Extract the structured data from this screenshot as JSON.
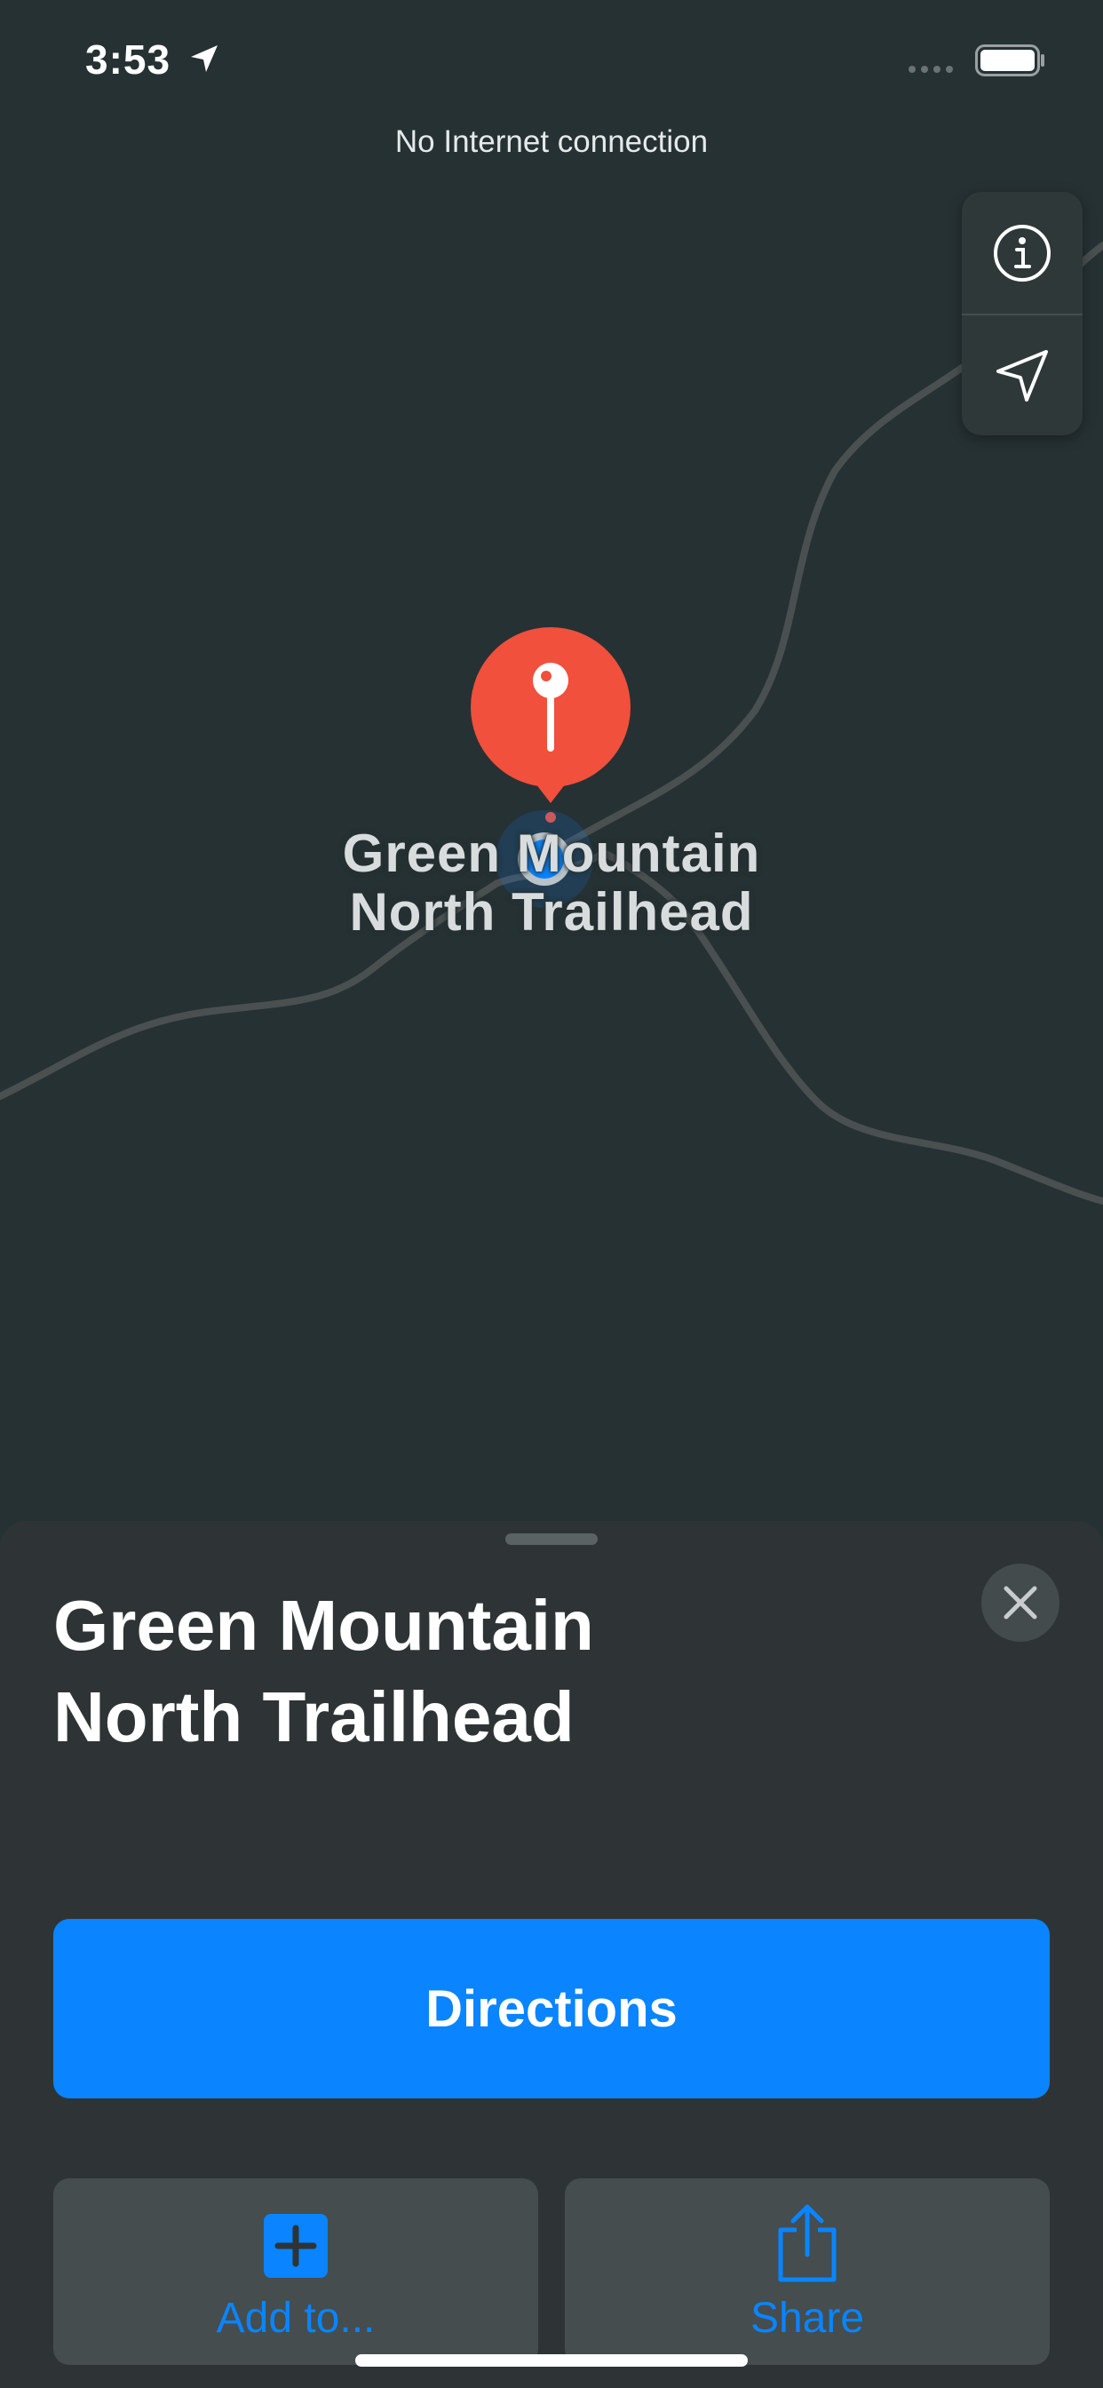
{
  "status_bar": {
    "time": "3:53",
    "location_icon": "location-arrow-icon",
    "signal_icon": "cellular-signal-icon",
    "battery_icon": "battery-icon"
  },
  "map": {
    "banner": "No Internet connection",
    "pin_label": "Green Mountain\nNorth Trailhead",
    "controls": {
      "info_icon": "info-icon",
      "location_icon": "navigation-arrow-icon"
    },
    "colors": {
      "background": "#263134",
      "road": "#4a4f50",
      "pin": "#f0503c",
      "user_location": "#0a84ff"
    }
  },
  "sheet": {
    "title": "Green Mountain\nNorth Trailhead",
    "close_icon": "close-icon",
    "directions_label": "Directions",
    "actions": [
      {
        "label": "Add to...",
        "icon": "plus-square-icon"
      },
      {
        "label": "Share",
        "icon": "share-icon"
      }
    ],
    "colors": {
      "accent": "#0a84ff",
      "sheet_bg": "#2e3435",
      "tile_bg": "#454d4e"
    }
  }
}
